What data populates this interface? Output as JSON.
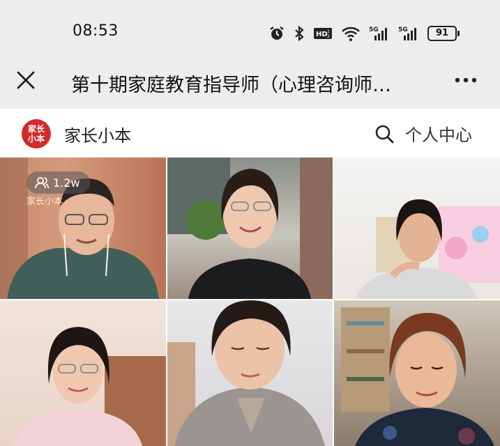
{
  "status_bar": {
    "time": "08:53",
    "battery_level": "91",
    "icons": [
      "alarm-icon",
      "bluetooth-icon",
      "hd-icon",
      "wifi-icon",
      "5g-signal-icon",
      "5g-signal-icon",
      "battery-icon"
    ]
  },
  "title_bar": {
    "title": "第十期家庭教育指导师（心理咨询师…",
    "close_icon": "close-icon",
    "more_icon": "more-icon"
  },
  "app_header": {
    "logo_text_line1": "家长",
    "logo_text_line2": "小本",
    "app_name": "家长小本",
    "search_icon": "search-icon",
    "profile_label": "个人中心"
  },
  "video_grid": {
    "viewer_count": "1.2w",
    "watermark": "家长小本",
    "tiles": [
      {
        "name": "participant-1"
      },
      {
        "name": "participant-2"
      },
      {
        "name": "participant-3"
      },
      {
        "name": "participant-4"
      },
      {
        "name": "participant-5"
      },
      {
        "name": "participant-6"
      }
    ]
  },
  "colors": {
    "bar_background": "#ededed",
    "logo_red": "#d22b2b"
  }
}
